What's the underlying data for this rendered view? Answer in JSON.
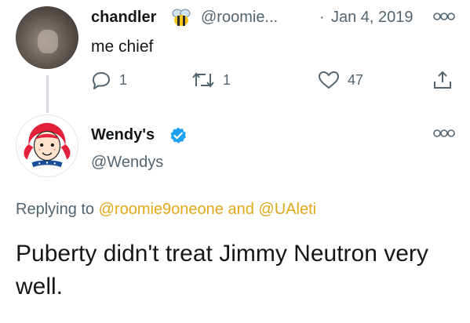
{
  "parent_tweet": {
    "display_name": "chandler",
    "name_emoji": "bee-emoji",
    "handle": "@roomie...",
    "separator": "·",
    "date": "Jan 4, 2019",
    "text": "me chief",
    "actions": {
      "reply_count": "1",
      "retweet_count": "1",
      "like_count": "47"
    }
  },
  "main_tweet": {
    "display_name": "Wendy's",
    "verified": true,
    "handle": "@Wendys",
    "replying_prefix": "Replying to",
    "mention_1": "@roomie9oneone",
    "replying_and": "and",
    "mention_2": "@UAleti",
    "text": "Puberty didn't treat Jimmy Neutron very well."
  },
  "colors": {
    "text_primary": "#14171a",
    "text_secondary": "#536471",
    "mention": "#e0a91b",
    "verified_blue": "#1da1f2",
    "wendys_red": "#e2203c",
    "thread_line": "#d7dde3"
  }
}
